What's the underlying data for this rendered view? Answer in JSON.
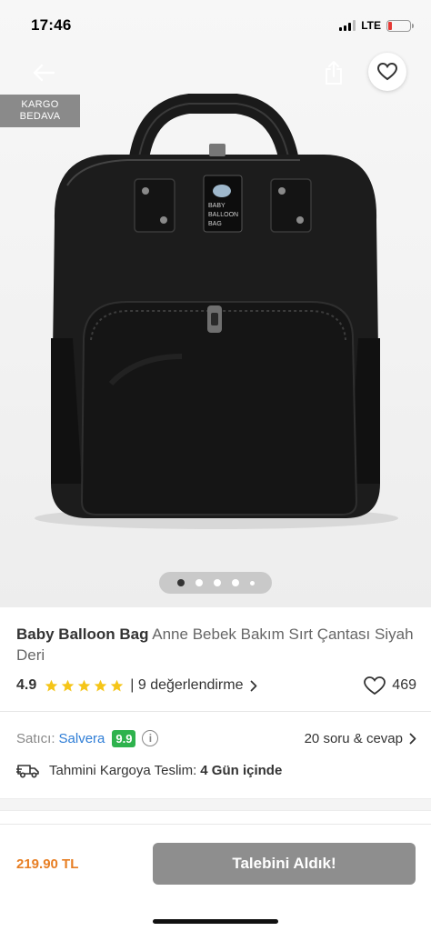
{
  "status_bar": {
    "time": "17:46",
    "network": "LTE"
  },
  "image_area": {
    "cargo_badge_line1": "KARGO",
    "cargo_badge_line2": "BEDAVA",
    "bag_label_line1": "BABY",
    "bag_label_line2": "BALLOON",
    "bag_label_line3": "BAG",
    "carousel_count": 5,
    "carousel_active_index": 0
  },
  "product": {
    "brand": "Baby Balloon Bag",
    "name": "Anne Bebek Bakım Sırt Çantası Siyah Deri",
    "rating": "4.9",
    "stars": 5,
    "review_text": "| 9 değerlendirme",
    "likes": "469"
  },
  "seller": {
    "label": "Satıcı:",
    "name": "Salvera",
    "score": "9.9",
    "qa_text": "20 soru & cevap"
  },
  "delivery": {
    "label": "Tahmini Kargoya Teslim:",
    "value": "4 Gün içinde"
  },
  "bottom_bar": {
    "price": "219.90 TL",
    "cta_label": "Talebini Aldık!"
  },
  "colors": {
    "accent_price": "#e77e23",
    "seller_link": "#2e7dd6",
    "score_badge": "#2eb24d",
    "star": "#f5c518",
    "cta_disabled": "#8e8e8e"
  },
  "icons": [
    "back-arrow-icon",
    "share-icon",
    "heart-icon",
    "star-icon",
    "chevron-right-icon",
    "info-icon",
    "truck-icon"
  ]
}
